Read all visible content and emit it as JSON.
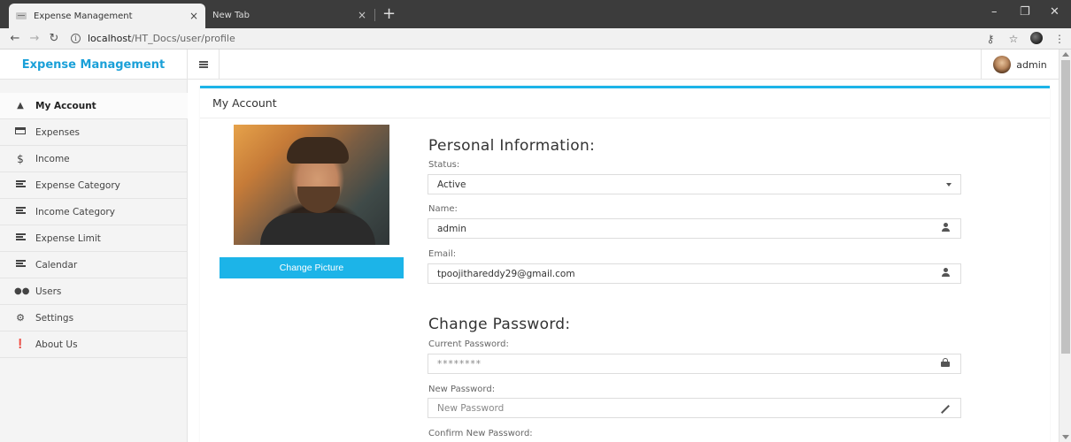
{
  "browser": {
    "active_tab_title": "Expense Management",
    "inactive_tab_title": "New Tab",
    "tab_close": "×",
    "new_tab": "+",
    "url_host": "localhost",
    "url_path": "/HT_Docs/user/profile",
    "minimize": "–",
    "restore": "❐",
    "close": "✕"
  },
  "header": {
    "brand_first": "Expense",
    "brand_second": "Management",
    "user_name": "admin"
  },
  "sidebar": {
    "items": [
      {
        "label": "My Account",
        "icon": "user-icon",
        "active": true
      },
      {
        "label": "Expenses",
        "icon": "credit-card-icon"
      },
      {
        "label": "Income",
        "icon": "dollar-icon"
      },
      {
        "label": "Expense Category",
        "icon": "list-icon"
      },
      {
        "label": "Income Category",
        "icon": "list-icon"
      },
      {
        "label": "Expense Limit",
        "icon": "list-icon"
      },
      {
        "label": "Calendar",
        "icon": "list-icon"
      },
      {
        "label": "Users",
        "icon": "users-icon"
      },
      {
        "label": "Settings",
        "icon": "gears-icon"
      },
      {
        "label": "About Us",
        "icon": "info-icon"
      }
    ]
  },
  "main": {
    "title": "My Account",
    "change_picture": "Change Picture",
    "personal_heading": "Personal Information:",
    "status_label": "Status:",
    "status_value": "Active",
    "name_label": "Name:",
    "name_value": "admin",
    "email_label": "Email:",
    "email_value": "tpoojithareddy29@gmail.com",
    "password_heading": "Change Password:",
    "current_password_label": "Current Password:",
    "current_password_value": "********",
    "new_password_label": "New Password:",
    "new_password_placeholder": "New Password",
    "confirm_password_label": "Confirm New Password:"
  },
  "colors": {
    "accent": "#1cb4e8",
    "brand": "#1aa0d8"
  }
}
